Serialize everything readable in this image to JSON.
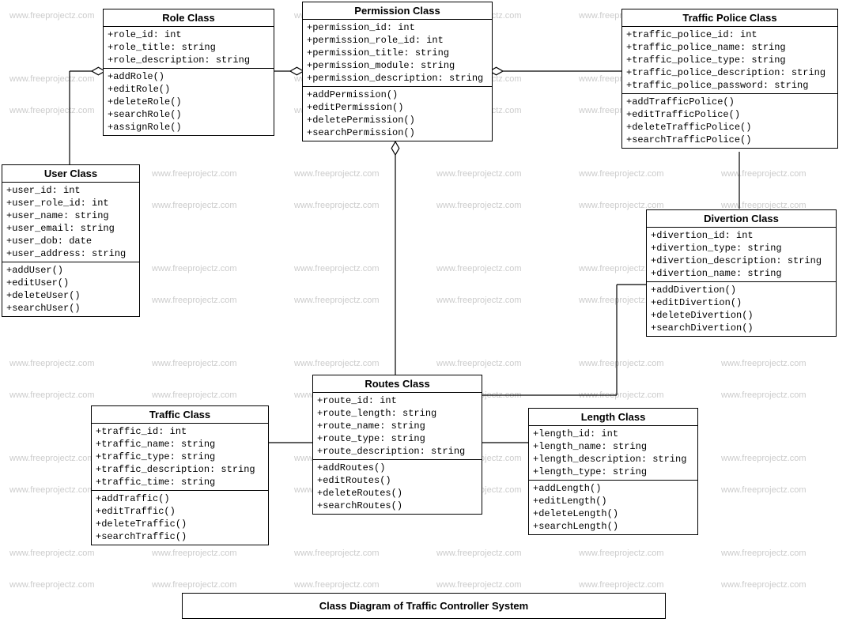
{
  "diagram_title": "Class Diagram of Traffic Controller System",
  "watermark_text": "www.freeprojectz.com",
  "classes": {
    "role": {
      "name": "Role Class",
      "attributes": [
        "+role_id: int",
        "+role_title: string",
        "+role_description: string"
      ],
      "methods": [
        "+addRole()",
        "+editRole()",
        "+deleteRole()",
        "+searchRole()",
        "+assignRole()"
      ]
    },
    "permission": {
      "name": "Permission Class",
      "attributes": [
        "+permission_id: int",
        "+permission_role_id: int",
        "+permission_title: string",
        "+permission_module: string",
        "+permission_description: string"
      ],
      "methods": [
        "+addPermission()",
        "+editPermission()",
        "+deletePermission()",
        "+searchPermission()"
      ]
    },
    "trafficpolice": {
      "name": "Traffic Police Class",
      "attributes": [
        "+traffic_police_id: int",
        "+traffic_police_name: string",
        "+traffic_police_type: string",
        "+traffic_police_description: string",
        "+traffic_police_password: string"
      ],
      "methods": [
        "+addTrafficPolice()",
        "+editTrafficPolice()",
        "+deleteTrafficPolice()",
        "+searchTrafficPolice()"
      ]
    },
    "user": {
      "name": "User Class",
      "attributes": [
        "+user_id: int",
        "+user_role_id: int",
        "+user_name: string",
        "+user_email: string",
        "+user_dob: date",
        "+user_address: string"
      ],
      "methods": [
        "+addUser()",
        "+editUser()",
        "+deleteUser()",
        "+searchUser()"
      ]
    },
    "divertion": {
      "name": "Divertion Class",
      "attributes": [
        "+divertion_id: int",
        "+divertion_type: string",
        "+divertion_description: string",
        "+divertion_name: string"
      ],
      "methods": [
        "+addDivertion()",
        "+editDivertion()",
        "+deleteDivertion()",
        "+searchDivertion()"
      ]
    },
    "routes": {
      "name": "Routes  Class",
      "attributes": [
        "+route_id: int",
        "+route_length: string",
        "+route_name: string",
        "+route_type: string",
        "+route_description: string"
      ],
      "methods": [
        "+addRoutes()",
        "+editRoutes()",
        "+deleteRoutes()",
        "+searchRoutes()"
      ]
    },
    "traffic": {
      "name": "Traffic Class",
      "attributes": [
        "+traffic_id: int",
        "+traffic_name: string",
        "+traffic_type: string",
        "+traffic_description: string",
        "+traffic_time: string"
      ],
      "methods": [
        "+addTraffic()",
        "+editTraffic()",
        "+deleteTraffic()",
        "+searchTraffic()"
      ]
    },
    "length": {
      "name": "Length Class",
      "attributes": [
        "+length_id: int",
        "+length_name: string",
        "+length_description: string",
        "+length_type: string"
      ],
      "methods": [
        "+addLength()",
        "+editLength()",
        "+deleteLength()",
        "+searchLength()"
      ]
    }
  },
  "chart_data": {
    "type": "uml_class_diagram",
    "relationships": [
      {
        "from": "User",
        "to": "Role",
        "type": "aggregation"
      },
      {
        "from": "Role",
        "to": "Permission",
        "type": "aggregation"
      },
      {
        "from": "Permission",
        "to": "Traffic Police",
        "type": "aggregation"
      },
      {
        "from": "Permission",
        "to": "Routes",
        "type": "aggregation"
      },
      {
        "from": "Routes",
        "to": "Traffic",
        "type": "association"
      },
      {
        "from": "Routes",
        "to": "Length",
        "type": "association"
      },
      {
        "from": "Routes",
        "to": "Divertion",
        "type": "association"
      },
      {
        "from": "Divertion",
        "to": "Traffic Police",
        "type": "association"
      }
    ]
  }
}
